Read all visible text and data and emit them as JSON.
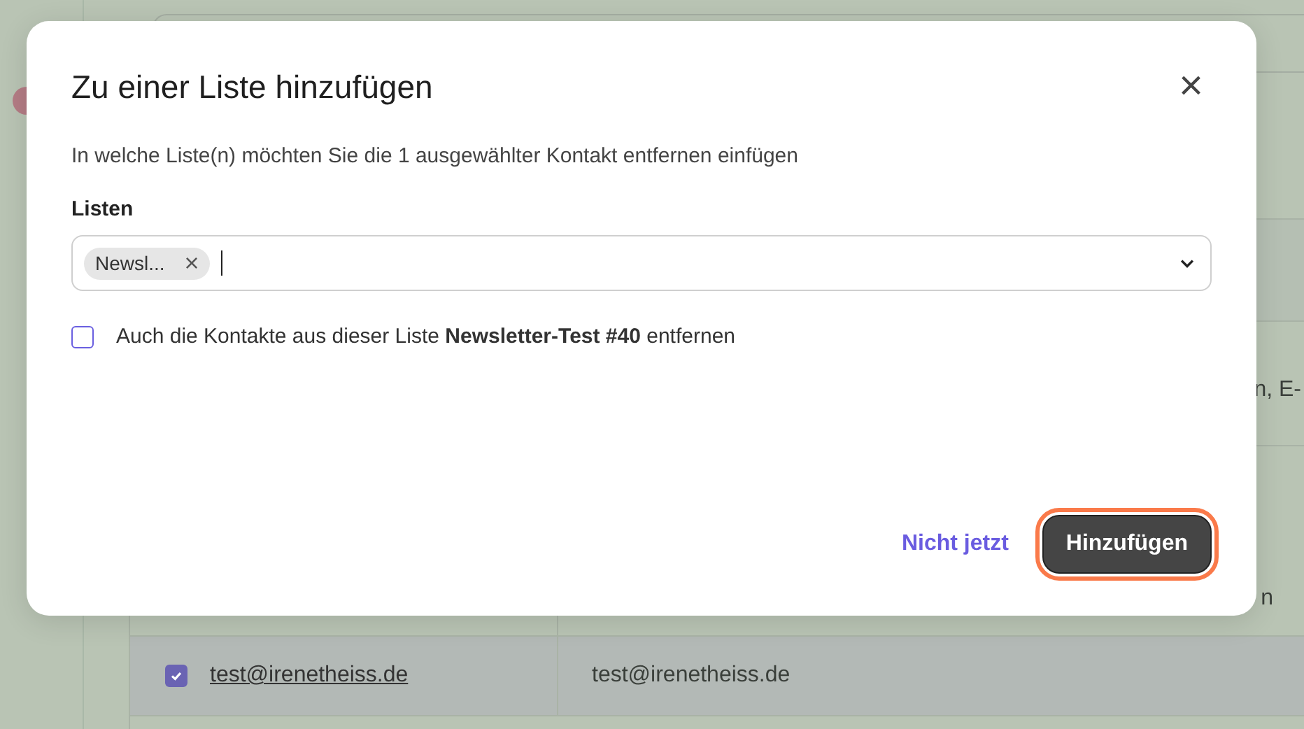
{
  "table": {
    "rows": [
      {
        "column_2": "n, E-"
      },
      {
        "column_2": "n"
      },
      {
        "selected": true,
        "column_1": "test@irenetheiss.de",
        "column_2": "test@irenetheiss.de"
      }
    ]
  },
  "dialog": {
    "title": "Zu einer Liste hinzufügen",
    "close": "×",
    "description": "In welche Liste(n) möchten Sie die 1 ausgewählter Kontakt entfernen einfügen",
    "field_label": "Listen",
    "chips": [
      {
        "label": "Newsl...",
        "remove": "×"
      }
    ],
    "option": {
      "label": "Auch die Kontakte aus dieser Liste **Newsletter-Test #40** entfernen",
      "checked": false
    },
    "buttons": [
      {
        "kind": "link",
        "label": "Nicht jetzt",
        "focused": false
      },
      {
        "kind": "primary",
        "label": "Hinzufügen",
        "focused": true
      }
    ]
  }
}
